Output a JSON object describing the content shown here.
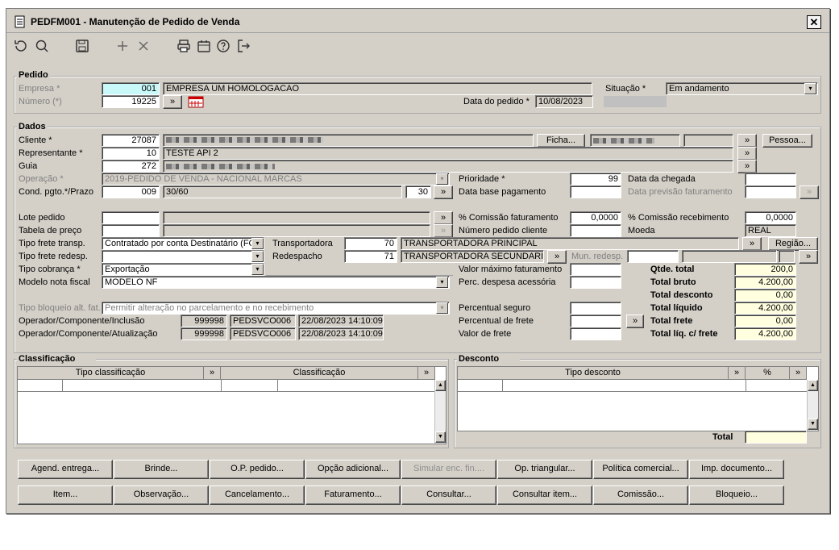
{
  "window": {
    "title": "PEDFM001 - Manutenção de Pedido de Venda",
    "close": "✕"
  },
  "pedido": {
    "title": "Pedido",
    "empresa_label": "Empresa *",
    "empresa_code": "001",
    "empresa_name": "EMPRESA UM HOMOLOGACAO",
    "numero_label": "Número (*)",
    "numero": "19225",
    "situacao_label": "Situação *",
    "situacao": "Em andamento",
    "data_label": "Data do pedido *",
    "data": "10/08/2023"
  },
  "dados": {
    "title": "Dados",
    "cliente_label": "Cliente *",
    "cliente_code": "27087",
    "ficha_btn": "Ficha...",
    "pessoa_btn": "Pessoa...",
    "representante_label": "Representante *",
    "representante_code": "10",
    "representante_name": "TESTE API 2",
    "guia_label": "Guia",
    "guia_code": "272",
    "operacao_label": "Operação *",
    "operacao": "2019-PEDIDO DE VENDA - NACIONAL MARCAS",
    "prioridade_label": "Prioridade *",
    "prioridade": "99",
    "data_chegada_label": "Data da chegada",
    "cond_label": "Cond. pgto.*/Prazo",
    "cond_code": "009",
    "cond_desc": "30/60",
    "prazo": "30",
    "data_base_label": "Data base pagamento",
    "data_prev_label": "Data previsão faturamento",
    "lote_label": "Lote pedido",
    "comissao_fat_label": "% Comissão faturamento",
    "comissao_fat": "0,0000",
    "comissao_rec_label": "% Comissão recebimento",
    "comissao_rec": "0,0000",
    "tabela_label": "Tabela de preço",
    "num_cliente_label": "Número pedido cliente",
    "moeda_label": "Moeda",
    "moeda": "REAL",
    "frete_transp_label": "Tipo frete transp.",
    "frete_transp": "Contratado por conta Destinatário (FOB)",
    "transportadora_label": "Transportadora",
    "transportadora_code": "70",
    "transportadora_name": "TRANSPORTADORA PRINCIPAL",
    "regiao_btn": "Região...",
    "frete_redesp_label": "Tipo frete redesp.",
    "redespacho_label": "Redespacho",
    "redespacho_code": "71",
    "redespacho_name": "TRANSPORTADORA SECUNDARIA",
    "mun_redesp_label": "Mun. redesp.",
    "cobranca_label": "Tipo cobrança *",
    "cobranca": "Exportação",
    "valor_max_label": "Valor máximo faturamento",
    "modelo_label": "Modelo nota fiscal",
    "modelo": "MODELO NF",
    "perc_desp_label": "Perc. despesa acessória",
    "bloqueio_label": "Tipo bloqueio alt. fat.",
    "bloqueio": "Permitir alteração no parcelamento e no recebimento",
    "perc_seguro_label": "Percentual seguro",
    "perc_frete_label": "Percentual de frete",
    "valor_frete_label": "Valor de frete",
    "op_inc_label": "Operador/Componente/Inclusão",
    "op_inc_code": "999998",
    "op_inc_comp": "PEDSVCO006",
    "op_inc_date": "22/08/2023 14:10:09",
    "op_atu_label": "Operador/Componente/Atualização",
    "op_atu_code": "999998",
    "op_atu_comp": "PEDSVCO006",
    "op_atu_date": "22/08/2023 14:10:09"
  },
  "totals": {
    "qtde_label": "Qtde. total",
    "qtde": "200,0",
    "bruto_label": "Total bruto",
    "bruto": "4.200,00",
    "desconto_label": "Total desconto",
    "desconto": "0,00",
    "liquido_label": "Total líquido",
    "liquido": "4.200,00",
    "frete_label": "Total frete",
    "frete": "0,00",
    "liq_frete_label": "Total líq. c/ frete",
    "liq_frete": "4.200,00"
  },
  "classificacao": {
    "title": "Classificação",
    "col1": "Tipo classificação",
    "col2": "Classificação"
  },
  "desconto": {
    "title": "Desconto",
    "col1": "Tipo desconto",
    "col2": "%",
    "total_label": "Total"
  },
  "buttons_row1": [
    "Agend. entrega...",
    "Brinde...",
    "O.P. pedido...",
    "Opção adicional...",
    "Simular enc. fin....",
    "Op. triangular...",
    "Política comercial...",
    "Imp. documento..."
  ],
  "buttons_row2": [
    "Item...",
    "Observação...",
    "Cancelamento...",
    "Faturamento...",
    "Consultar...",
    "Consultar item...",
    "Comissão...",
    "Bloqueio..."
  ],
  "common": {
    "arrow": "»",
    "dropdown": "▾"
  },
  "colors": {
    "highlight_cyan": "#c8f8f8",
    "total_yellow": "#ffffe0",
    "window_bg": "#d4d0c8"
  }
}
